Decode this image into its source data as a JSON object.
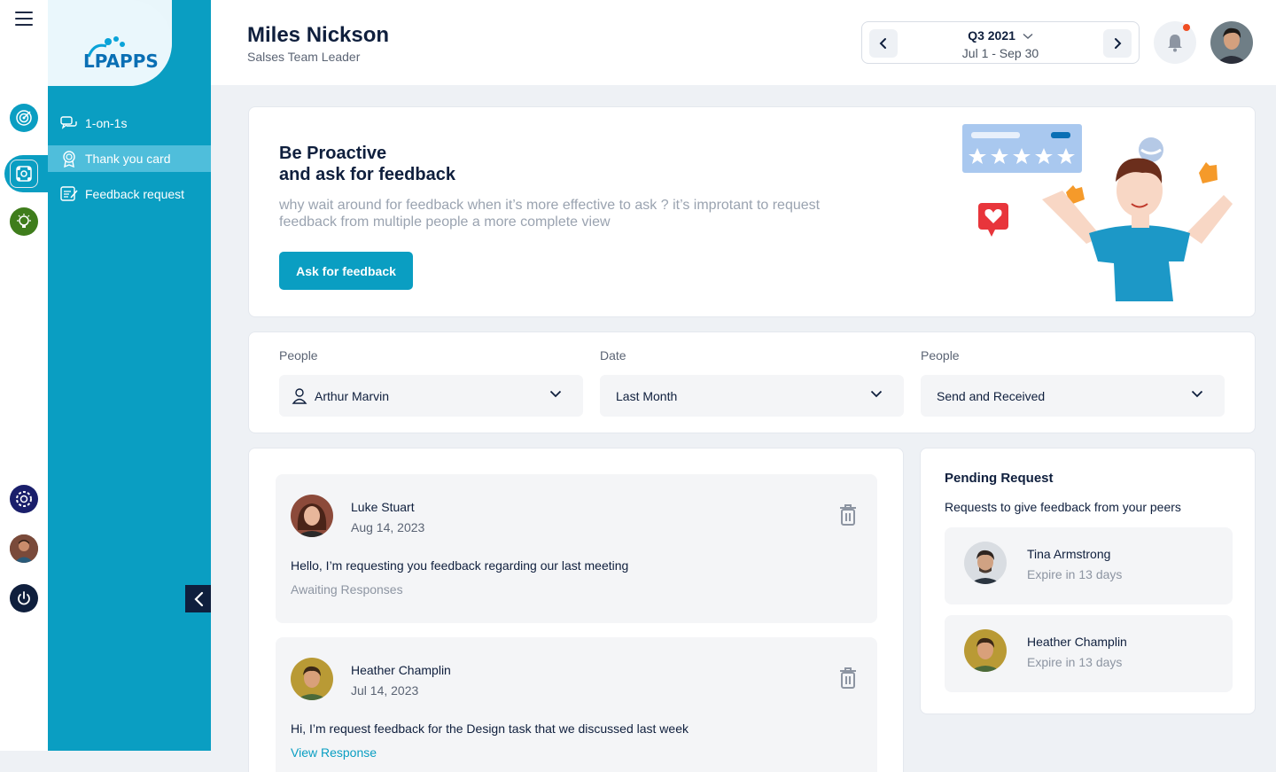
{
  "sidebar": {
    "logo_text": "LPAPPS",
    "items": [
      {
        "label": "1-on-1s"
      },
      {
        "label": "Thank you card"
      },
      {
        "label": "Feedback request"
      }
    ]
  },
  "header": {
    "user_name": "Miles Nickson",
    "user_role": "Salses Team Leader",
    "period": {
      "quarter": "Q3 2021",
      "range": "Jul 1 - Sep 30"
    }
  },
  "hero": {
    "title_line1": "Be Proactive",
    "title_line2": "and ask for feedback",
    "description": "why wait around for feedback when it’s more effective to ask ? it’s improtant to request feedback from multiple people a more complete view",
    "button_label": "Ask for feedback"
  },
  "filters": [
    {
      "label": "People",
      "value": "Arthur Marvin"
    },
    {
      "label": "Date",
      "value": "Last Month"
    },
    {
      "label": "People",
      "value": "Send and Received"
    }
  ],
  "requests": [
    {
      "name": "Luke Stuart",
      "date": "Aug 14, 2023",
      "message": "Hello, I’m requesting you feedback regarding our last meeting",
      "status": "Awaiting Responses"
    },
    {
      "name": "Heather Champlin",
      "date": "Jul 14, 2023",
      "message": "Hi, I’m request feedback for the Design task that we discussed last week",
      "link": "View Response"
    }
  ],
  "pending": {
    "title": "Pending Request",
    "subtitle": "Requests to give feedback from your peers",
    "items": [
      {
        "name": "Tina Armstrong",
        "expiry": "Expire in 13 days"
      },
      {
        "name": "Heather Champlin",
        "expiry": "Expire in 13 days"
      }
    ]
  },
  "colors": {
    "accent": "#0a9ec2",
    "navy": "#0f1f3d",
    "notification": "#f04e23"
  }
}
